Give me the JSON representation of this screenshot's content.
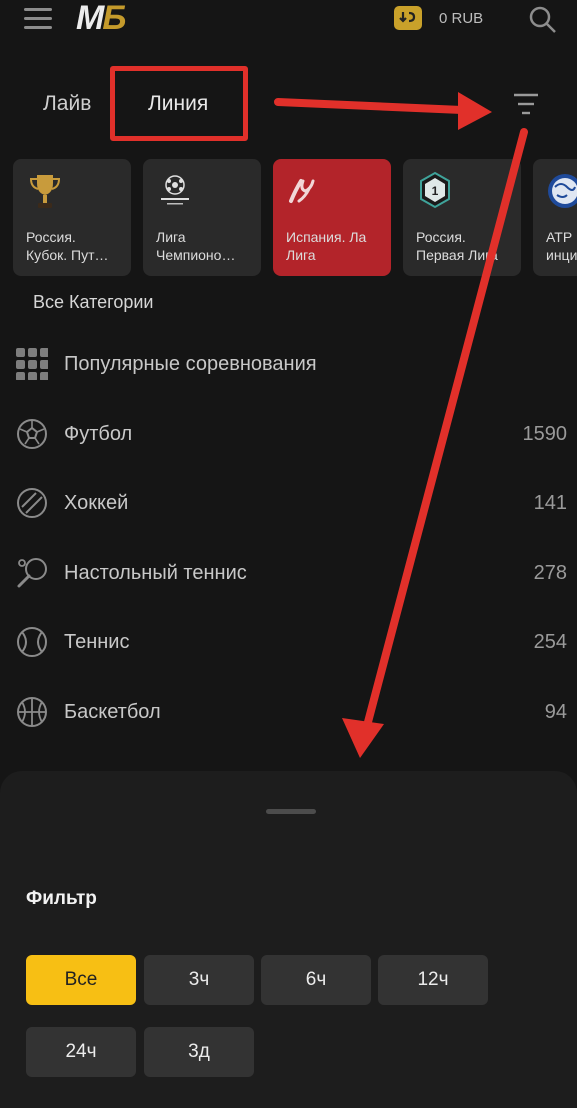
{
  "header": {
    "logo_m": "M",
    "logo_b": "Б",
    "balance": "0 RUB"
  },
  "tabs": {
    "live": "Лайв",
    "line": "Линия"
  },
  "leagues": [
    {
      "label": "Россия.\nКубок. Пут…",
      "icon": "trophy-icon",
      "active": false
    },
    {
      "label": "Лига\nЧемпионо…",
      "icon": "champions-league-icon",
      "active": false
    },
    {
      "label": "Испания. Ла\nЛига",
      "icon": "laliga-icon",
      "active": true
    },
    {
      "label": "Россия.\nПервая Лига",
      "icon": "first-league-icon",
      "active": false
    },
    {
      "label": "ATP\nинци",
      "icon": "atp-globe-icon",
      "active": false
    }
  ],
  "all_categories": "Все Категории",
  "sports": [
    {
      "name": "Популярные соревнования",
      "count": "",
      "icon": "grid-icon"
    },
    {
      "name": "Футбол",
      "count": "1590",
      "icon": "football-icon"
    },
    {
      "name": "Хоккей",
      "count": "141",
      "icon": "hockey-puck-icon"
    },
    {
      "name": "Настольный теннис",
      "count": "278",
      "icon": "table-tennis-icon"
    },
    {
      "name": "Теннис",
      "count": "254",
      "icon": "tennis-ball-icon"
    },
    {
      "name": "Баскетбол",
      "count": "94",
      "icon": "basketball-icon"
    }
  ],
  "filter": {
    "title": "Фильтр",
    "options": [
      "Все",
      "3ч",
      "6ч",
      "12ч",
      "24ч",
      "3д"
    ],
    "selected": "Все"
  },
  "colors": {
    "accent": "#f7bf14",
    "active_card": "#b3242a",
    "annotation": "#e1302a"
  }
}
